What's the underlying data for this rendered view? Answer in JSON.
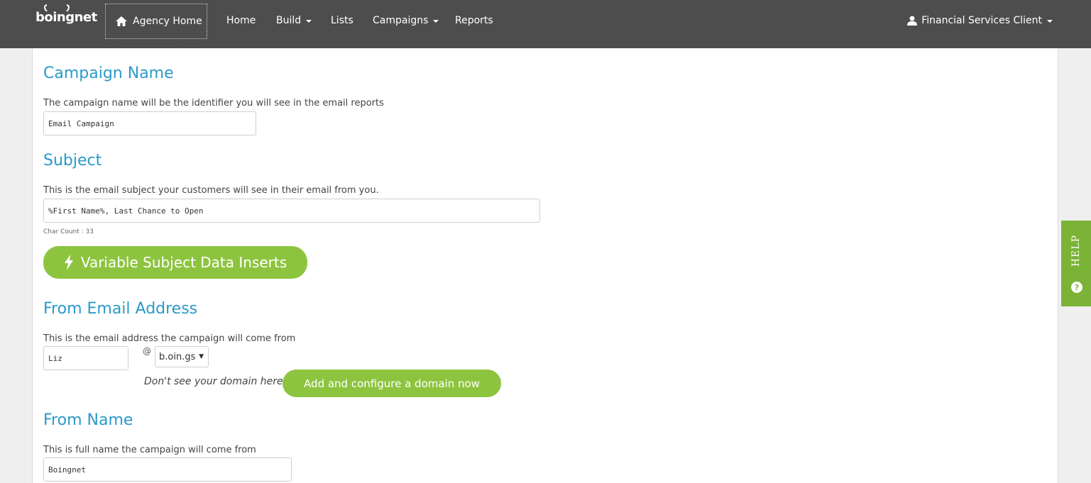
{
  "brand": {
    "logo_text": "boingnet"
  },
  "nav": {
    "agency_home": "Agency Home",
    "items": [
      {
        "label": "Home",
        "dropdown": false
      },
      {
        "label": "Build",
        "dropdown": true
      },
      {
        "label": "Lists",
        "dropdown": false
      },
      {
        "label": "Campaigns",
        "dropdown": true
      },
      {
        "label": "Reports",
        "dropdown": false
      }
    ],
    "user": "Financial Services Client"
  },
  "campaign_name": {
    "title": "Campaign Name",
    "description": "The campaign name will be the identifier you will see in the email reports",
    "value": "Email Campaign"
  },
  "subject": {
    "title": "Subject",
    "description": "This is the email subject your customers will see in their email from you.",
    "value": "%First Name%, Last Chance to Open",
    "char_count": "Char Count : 33",
    "inserts_button": "Variable Subject Data Inserts"
  },
  "from_email": {
    "title": "From Email Address",
    "description": "This is the email address the campaign will come from",
    "local_part": "Liz",
    "at": "@",
    "domain": "b.oin.gs",
    "hint": "Don't see your domain here?",
    "add_domain_button": "Add and configure a domain now"
  },
  "from_name": {
    "title": "From Name",
    "description": "This is full name the campaign will come from",
    "value": "Boingnet"
  },
  "help_tab": {
    "label": "HELP"
  },
  "colors": {
    "accent_blue": "#2a9ac9",
    "green": "#8dc43f",
    "topbar": "#4d4d4d"
  }
}
